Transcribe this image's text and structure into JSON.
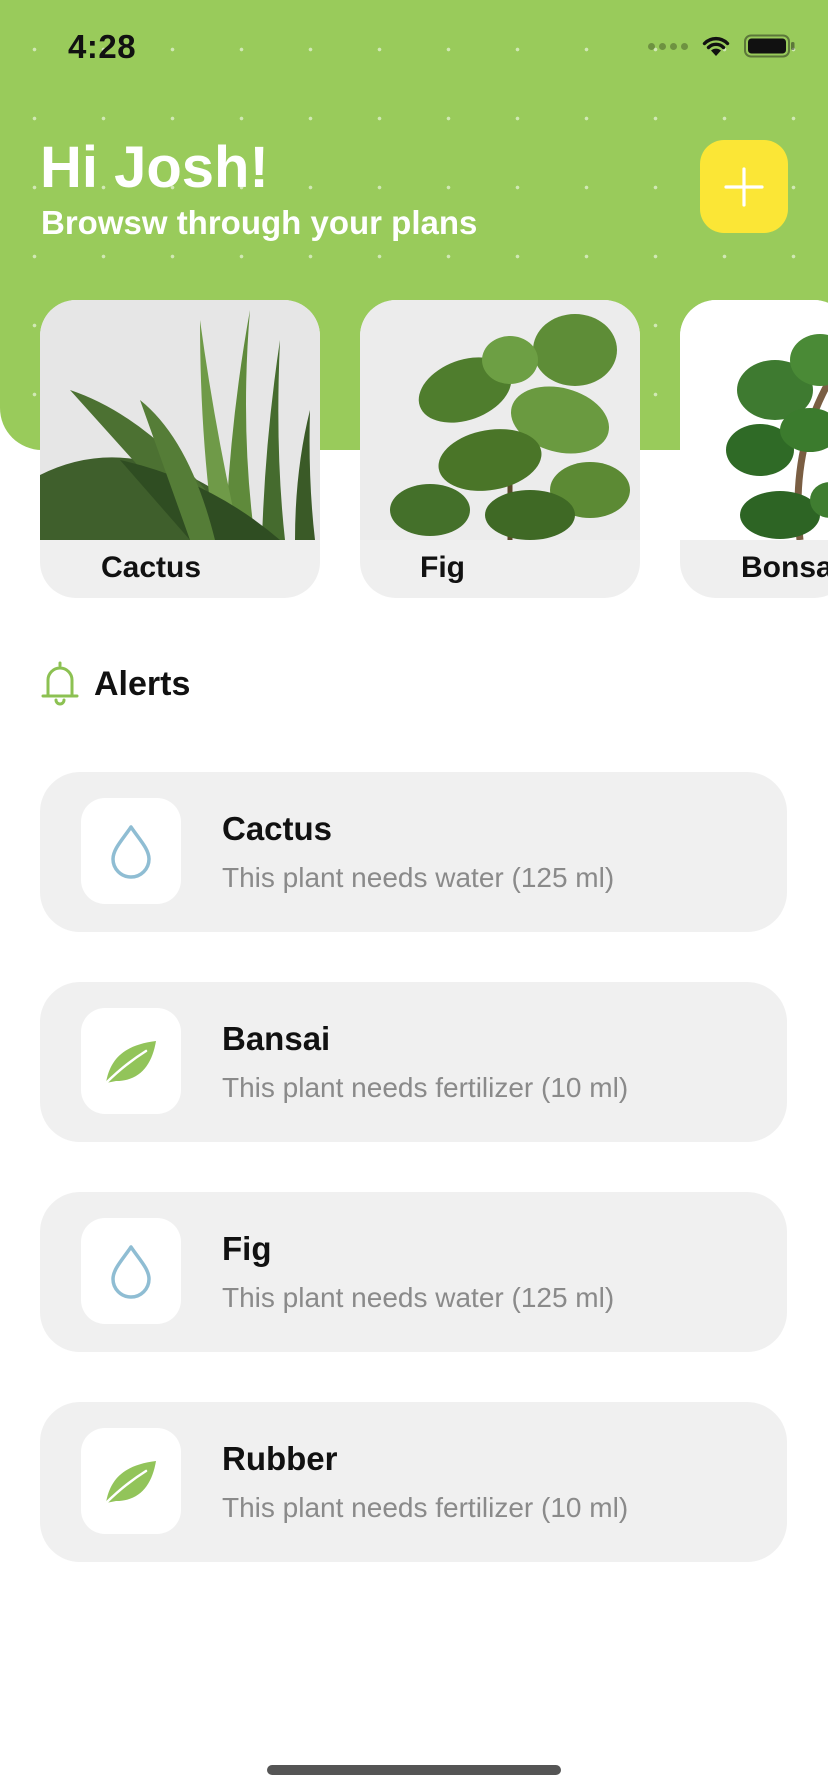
{
  "status": {
    "time": "4:28"
  },
  "header": {
    "greeting": "Hi Josh!",
    "subtitle": "Browsw through your plans",
    "accent": "#99cb5b",
    "add_button_color": "#fbe636"
  },
  "plants": [
    {
      "name": "Cactus",
      "icon": "aloe-photo"
    },
    {
      "name": "Fig",
      "icon": "fig-photo"
    },
    {
      "name": "Bonsa",
      "icon": "bonsai-photo"
    }
  ],
  "alerts": {
    "title": "Alerts",
    "icon": "bell-icon",
    "items": [
      {
        "name": "Cactus",
        "message": "This plant needs water (125 ml)",
        "icon": "water-drop-icon"
      },
      {
        "name": "Bansai",
        "message": "This plant needs fertilizer (10 ml)",
        "icon": "leaf-icon"
      },
      {
        "name": "Fig",
        "message": "This plant needs water (125 ml)",
        "icon": "water-drop-icon"
      },
      {
        "name": "Rubber",
        "message": "This plant needs fertilizer (10 ml)",
        "icon": "leaf-icon"
      }
    ]
  }
}
